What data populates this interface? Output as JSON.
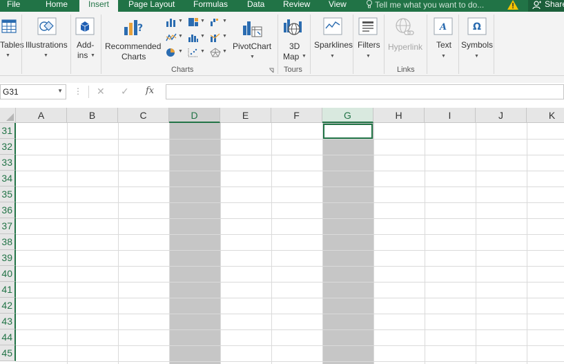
{
  "tabs": [
    "File",
    "Home",
    "Insert",
    "Page Layout",
    "Formulas",
    "Data",
    "Review",
    "View"
  ],
  "active_tab": "Insert",
  "tell_me": "Tell me what you want to do...",
  "share": "Share",
  "ribbon": {
    "tables": "Tables",
    "illustrations": "Illustrations",
    "addins_line1": "Add-",
    "addins_line2": "ins",
    "recommended_line1": "Recommended",
    "recommended_line2": "Charts",
    "pivotchart": "PivotChart",
    "map_line1": "3D",
    "map_line2": "Map",
    "sparklines": "Sparklines",
    "filters": "Filters",
    "hyperlink": "Hyperlink",
    "text": "Text",
    "symbols": "Symbols",
    "groups": {
      "charts": "Charts",
      "tours": "Tours",
      "links": "Links"
    }
  },
  "formula_bar": {
    "name_box": "G31",
    "fx": "fx",
    "formula": ""
  },
  "columns": [
    "A",
    "B",
    "C",
    "D",
    "E",
    "F",
    "G",
    "H",
    "I",
    "J",
    "K"
  ],
  "rows": [
    "31",
    "32",
    "33",
    "34",
    "35",
    "36",
    "37",
    "38",
    "39",
    "40",
    "41",
    "42",
    "43",
    "44",
    "45"
  ],
  "selected_columns": [
    "D",
    "G"
  ],
  "active_cell": "G31",
  "colors": {
    "brand": "#217346",
    "selection_fill": "#c6c6c6"
  }
}
